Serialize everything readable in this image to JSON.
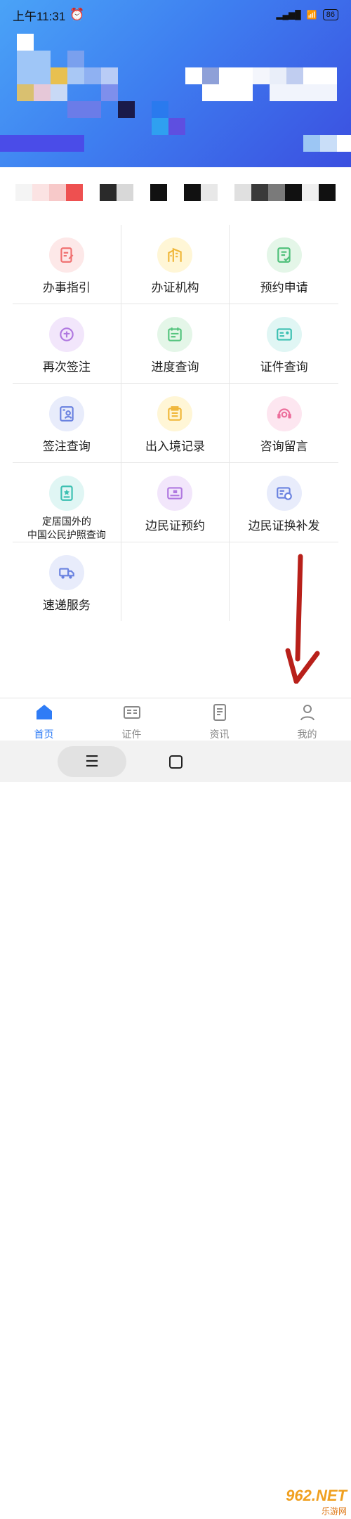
{
  "status_bar": {
    "time": "上午11:31",
    "battery": "86"
  },
  "services": [
    {
      "label": "办事指引",
      "icon": "document-edit-icon",
      "bg": "#fde8e8",
      "fg": "#f07070"
    },
    {
      "label": "办证机构",
      "icon": "building-icon",
      "bg": "#fff6d6",
      "fg": "#f0b73a"
    },
    {
      "label": "预约申请",
      "icon": "appointment-check-icon",
      "bg": "#e4f6e8",
      "fg": "#4fc07a"
    },
    {
      "label": "再次签注",
      "icon": "endorse-stamp-icon",
      "bg": "#f2e6fb",
      "fg": "#b078e0"
    },
    {
      "label": "进度查询",
      "icon": "calendar-progress-icon",
      "bg": "#e4f6e8",
      "fg": "#55c47e"
    },
    {
      "label": "证件查询",
      "icon": "id-card-icon",
      "bg": "#e0f6f4",
      "fg": "#3cc0b2"
    },
    {
      "label": "签注查询",
      "icon": "person-document-icon",
      "bg": "#e8ecfb",
      "fg": "#6a82e0"
    },
    {
      "label": "出入境记录",
      "icon": "record-folder-icon",
      "bg": "#fff6d6",
      "fg": "#f0b73a"
    },
    {
      "label": "咨询留言",
      "icon": "customer-service-icon",
      "bg": "#fde6f0",
      "fg": "#ec6f9c"
    },
    {
      "label": "定居国外的\n中国公民护照查询",
      "icon": "passport-icon",
      "bg": "#e0f6f4",
      "fg": "#3cc0b2"
    },
    {
      "label": "边民证预约",
      "icon": "border-permit-icon",
      "bg": "#f2e6fb",
      "fg": "#b078e0"
    },
    {
      "label": "边民证换补发",
      "icon": "border-permit-renew-icon",
      "bg": "#e8ecfb",
      "fg": "#6a82e0"
    },
    {
      "label": "速递服务",
      "icon": "delivery-truck-icon",
      "bg": "#e8ecfb",
      "fg": "#6a82e0"
    }
  ],
  "tabbar": [
    {
      "label": "首页",
      "icon": "home-icon",
      "active": true
    },
    {
      "label": "证件",
      "icon": "id-card-tab-icon",
      "active": false
    },
    {
      "label": "资讯",
      "icon": "news-icon",
      "active": false
    },
    {
      "label": "我的",
      "icon": "person-icon",
      "active": false
    }
  ],
  "watermark": {
    "big": "962.NET",
    "small": "乐游网"
  },
  "colors": {
    "accent": "#2f7cf6",
    "arrow": "#b8201a"
  }
}
